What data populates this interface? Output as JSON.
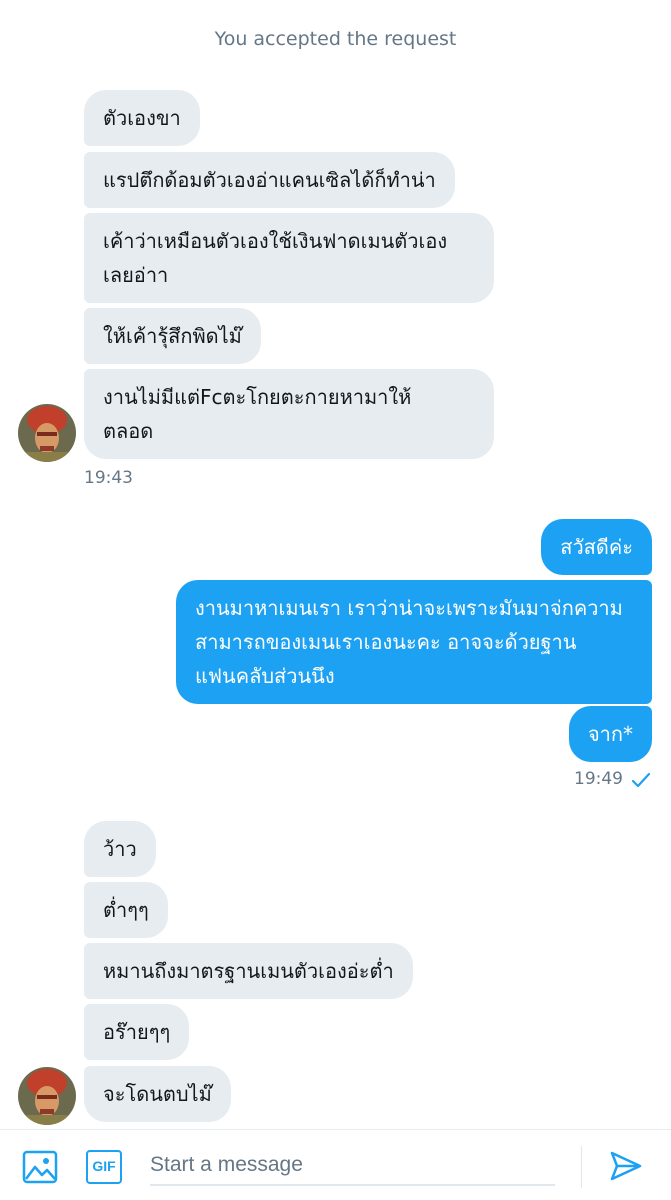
{
  "conversation": {
    "system_note": "You accepted the request",
    "group1": {
      "messages": [
        "ตัวเองขา",
        "แรปตึกด้อมตัวเองอ่าแคนเซิลได้ก็ทำน่า",
        "เค้าว่าเหมือนตัวเองใช้เงินฟาดเมนตัวเอง\nเลยอ่าา",
        "ให้เค้ารุ้สึกพิดไม๊",
        "งานไม่มีแต่Fcตะโกยตะกายหามาให้\nตลอด"
      ],
      "time": "19:43"
    },
    "group2": {
      "messages": [
        "สวัสดีค่ะ",
        "งานมาหาเมนเรา เราว่าน่าจะเพราะมันมาจ่กความ\nสามารถของเมนเราเองนะคะ อาจจะด้วยฐาน\nแฟนคลับส่วนนึง",
        "จาก*"
      ],
      "time": "19:49"
    },
    "group3": {
      "messages": [
        "ว้าว",
        "ต่ำๆๆ",
        "หมานถึงมาตรฐานเมนตัวเองอ่ะต่ำ",
        "อร๊ายๆๆ",
        "จะโดนตบไม๊"
      ]
    }
  },
  "composer": {
    "placeholder": "Start a message",
    "gif_label": "GIF",
    "icons": [
      "image-icon",
      "gif-icon",
      "send-icon"
    ]
  },
  "colors": {
    "accent": "#1da1f2",
    "incoming_bubble": "#e6ecf0",
    "muted_text": "#657786"
  }
}
